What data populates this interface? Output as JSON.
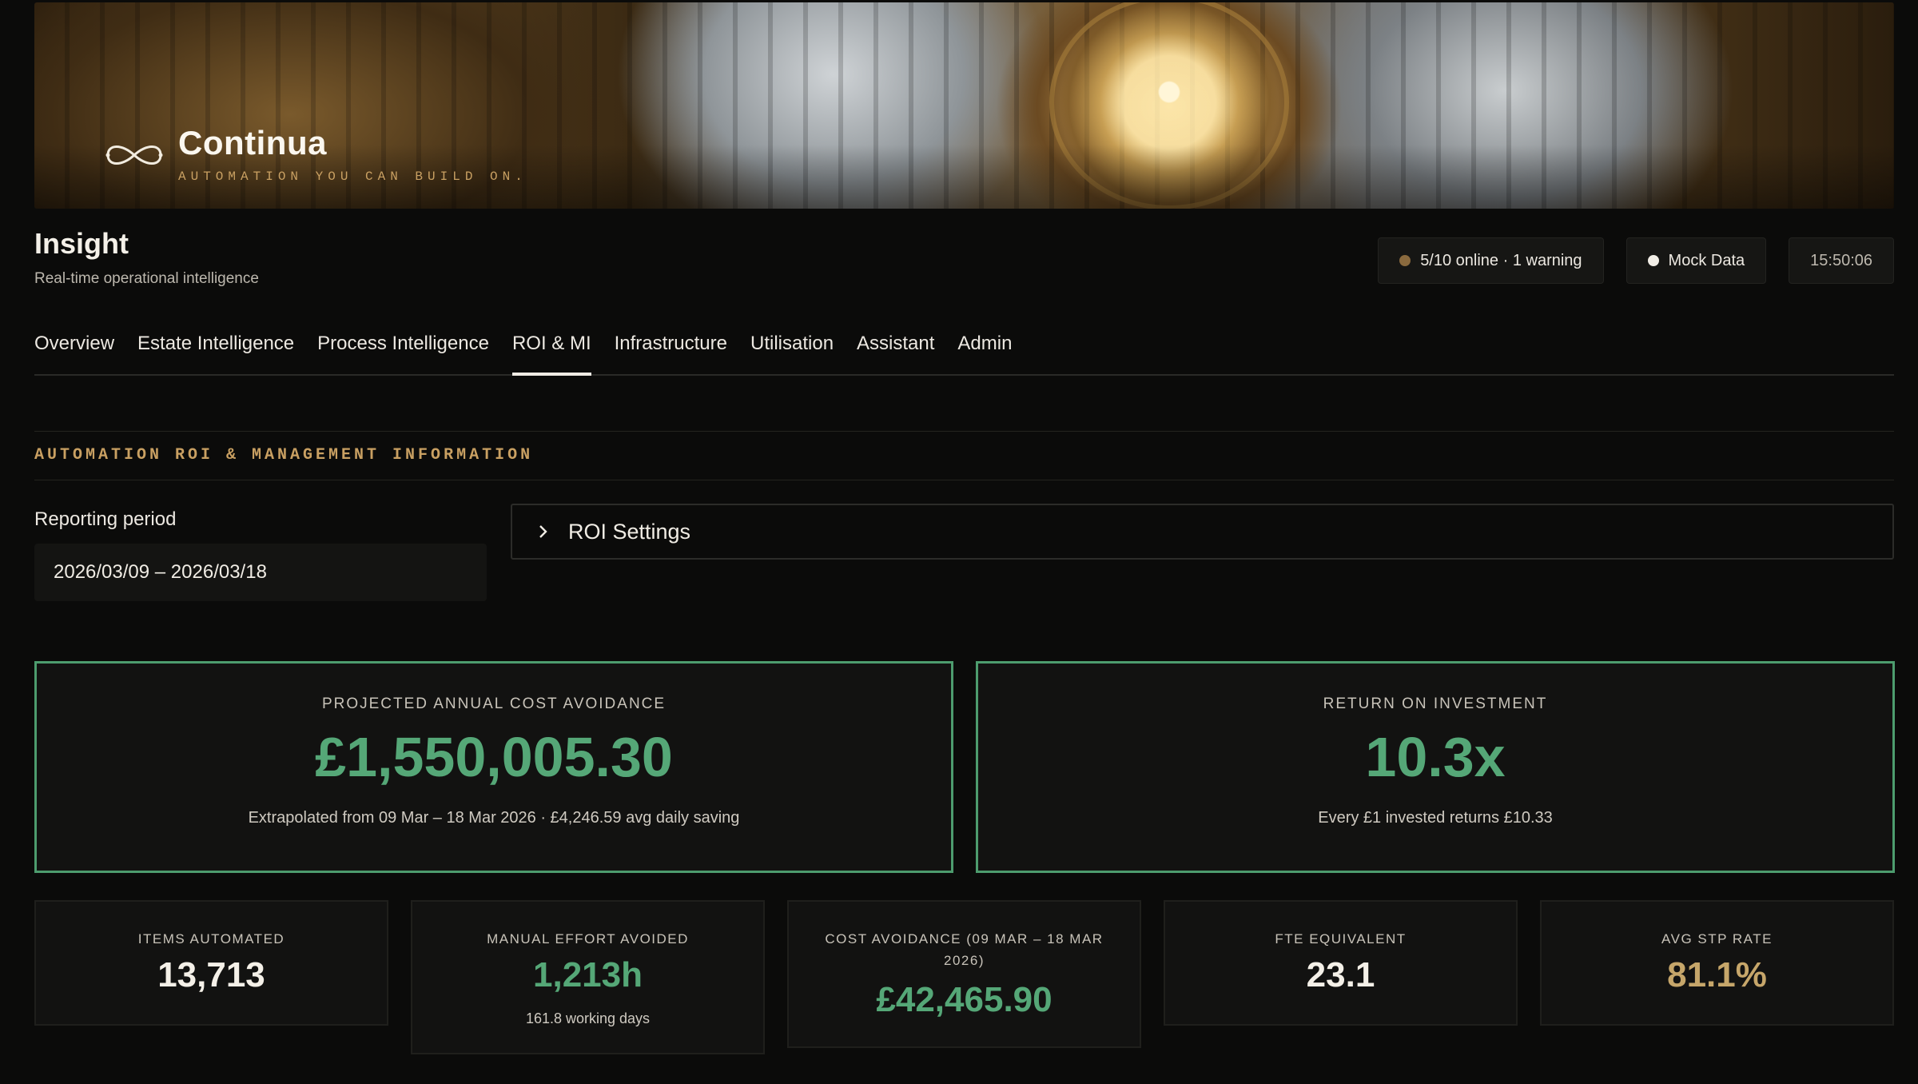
{
  "brand": {
    "name": "Continua",
    "tagline": "AUTOMATION YOU CAN BUILD ON."
  },
  "header": {
    "title": "Insight",
    "subtitle": "Real-time operational intelligence",
    "status": "5/10 online · 1 warning",
    "status_color": "#8a6a3e",
    "data_source": "Mock Data",
    "data_source_color": "#f1ede6",
    "clock": "15:50:06"
  },
  "tabs": [
    {
      "label": "Overview"
    },
    {
      "label": "Estate Intelligence"
    },
    {
      "label": "Process Intelligence"
    },
    {
      "label": "ROI & MI",
      "active": true
    },
    {
      "label": "Infrastructure"
    },
    {
      "label": "Utilisation"
    },
    {
      "label": "Assistant"
    },
    {
      "label": "Admin"
    }
  ],
  "section": {
    "title": "AUTOMATION ROI & MANAGEMENT INFORMATION"
  },
  "reporting": {
    "label": "Reporting period",
    "value": "2026/03/09 – 2026/03/18"
  },
  "roi_settings": {
    "label": "ROI Settings"
  },
  "hero": {
    "cost_avoidance": {
      "label": "PROJECTED ANNUAL COST AVOIDANCE",
      "value": "£1,550,005.30",
      "sub": "Extrapolated from 09 Mar – 18 Mar 2026 · £4,246.59 avg daily saving"
    },
    "roi": {
      "label": "RETURN ON INVESTMENT",
      "value": "10.3x",
      "sub": "Every £1 invested returns £10.33"
    }
  },
  "stats": {
    "items_automated": {
      "label": "ITEMS AUTOMATED",
      "value": "13,713"
    },
    "manual_effort": {
      "label": "MANUAL EFFORT AVOIDED",
      "value": "1,213h",
      "sub": "161.8 working days"
    },
    "cost_avoidance": {
      "label": "COST AVOIDANCE (09 MAR – 18 MAR 2026)",
      "value": "£42,465.90"
    },
    "fte": {
      "label": "FTE EQUIVALENT",
      "value": "23.1"
    },
    "stp": {
      "label": "AVG STP RATE",
      "value": "81.1%"
    }
  },
  "colors": {
    "accent_gold": "#c9a062",
    "positive_green": "#55a777",
    "card_border_green": "#4d9c6e",
    "stp_gold": "#c6a66a"
  }
}
